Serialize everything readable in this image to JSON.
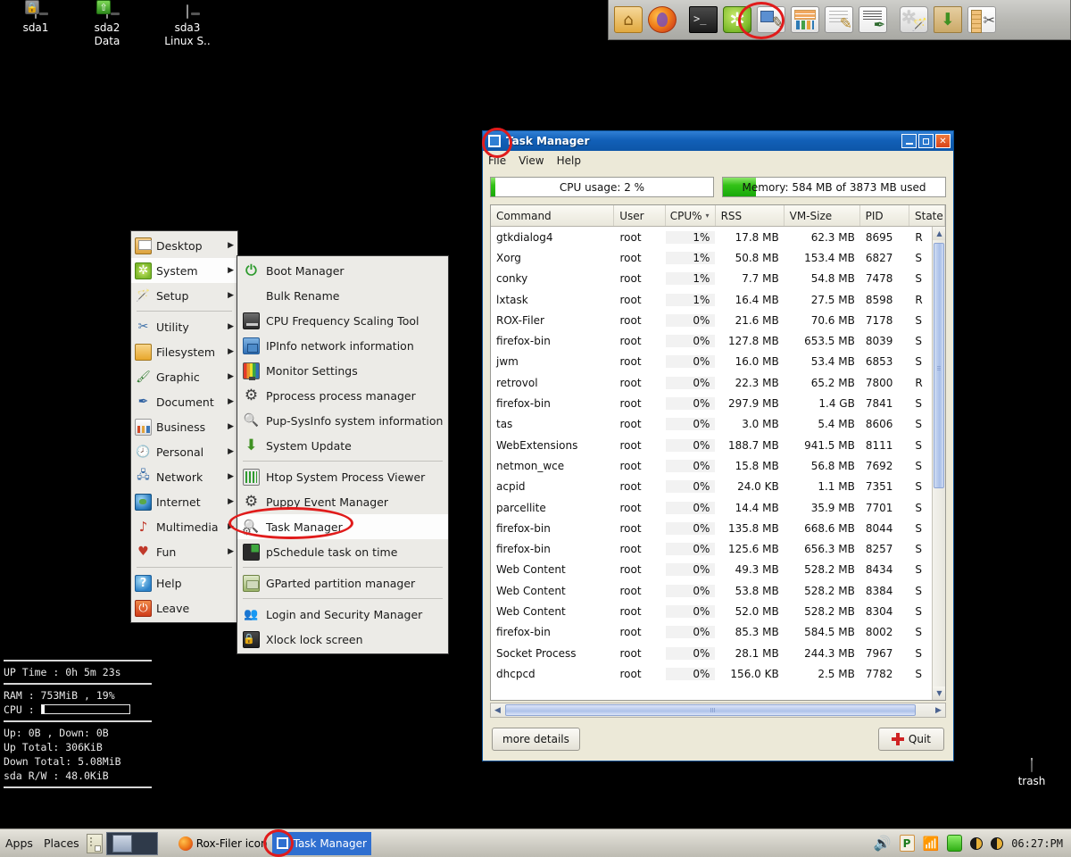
{
  "desktop": {
    "icons": [
      {
        "name": "sda1",
        "sub": "",
        "badge": "lock"
      },
      {
        "name": "sda2",
        "sub": "Data",
        "badge": "mount"
      },
      {
        "name": "sda3",
        "sub": "Linux S..",
        "badge": "none"
      }
    ],
    "trash_label": "trash"
  },
  "launchbar": {
    "items": [
      {
        "icon": "home-folder-icon",
        "tip": "filemanager"
      },
      {
        "icon": "firefox-icon",
        "tip": "browser"
      },
      {
        "icon": "terminal-icon",
        "tip": "terminal"
      },
      {
        "icon": "settings-gear-icon",
        "tip": "setup"
      },
      {
        "icon": "text-editor-icon",
        "tip": "editor"
      },
      {
        "icon": "spreadsheet-icon",
        "tip": "spreadsheet"
      },
      {
        "icon": "wordprocessor-icon",
        "tip": "wordprocessor"
      },
      {
        "icon": "document-pen-icon",
        "tip": "document"
      },
      {
        "icon": "tools-icon",
        "tip": "tools"
      },
      {
        "icon": "package-install-icon",
        "tip": "install"
      },
      {
        "icon": "measure-cut-icon",
        "tip": "utility"
      }
    ]
  },
  "mainmenu": {
    "items": [
      {
        "label": "Desktop",
        "icon": "desktop-icon",
        "arrow": "▶",
        "selected": false,
        "sep_after": false
      },
      {
        "label": "System",
        "icon": "system-gear-icon",
        "arrow": "▶",
        "selected": true,
        "sep_after": false
      },
      {
        "label": "Setup",
        "icon": "setup-wand-icon",
        "arrow": "▶",
        "selected": false,
        "sep_after": true
      },
      {
        "label": "Utility",
        "icon": "utility-icon",
        "arrow": "▶",
        "selected": false,
        "sep_after": false
      },
      {
        "label": "Filesystem",
        "icon": "folder-icon",
        "arrow": "▶",
        "selected": false,
        "sep_after": false
      },
      {
        "label": "Graphic",
        "icon": "graphic-brush-icon",
        "arrow": "▶",
        "selected": false,
        "sep_after": false
      },
      {
        "label": "Document",
        "icon": "document-icon",
        "arrow": "▶",
        "selected": false,
        "sep_after": false
      },
      {
        "label": "Business",
        "icon": "business-chart-icon",
        "arrow": "▶",
        "selected": false,
        "sep_after": false
      },
      {
        "label": "Personal",
        "icon": "personal-clock-icon",
        "arrow": "▶",
        "selected": false,
        "sep_after": false
      },
      {
        "label": "Network",
        "icon": "network-icon",
        "arrow": "▶",
        "selected": false,
        "sep_after": false
      },
      {
        "label": "Internet",
        "icon": "internet-globe-icon",
        "arrow": "▶",
        "selected": false,
        "sep_after": false
      },
      {
        "label": "Multimedia",
        "icon": "multimedia-icon",
        "arrow": "▶",
        "selected": false,
        "sep_after": false
      },
      {
        "label": "Fun",
        "icon": "fun-cards-icon",
        "arrow": "▶",
        "selected": false,
        "sep_after": true
      },
      {
        "label": "Help",
        "icon": "help-icon",
        "arrow": "",
        "selected": false,
        "sep_after": false
      },
      {
        "label": "Leave",
        "icon": "leave-power-icon",
        "arrow": "",
        "selected": false,
        "sep_after": false
      }
    ]
  },
  "submenu": {
    "items": [
      {
        "label": "Boot Manager",
        "icon": "power-icon",
        "selected": false,
        "sep_after": false
      },
      {
        "label": "Bulk Rename",
        "icon": "none",
        "selected": false,
        "sep_after": false
      },
      {
        "label": "CPU Frequency Scaling Tool",
        "icon": "cpu-icon",
        "selected": false,
        "sep_after": false
      },
      {
        "label": "IPInfo network information",
        "icon": "network-info-icon",
        "selected": false,
        "sep_after": false
      },
      {
        "label": "Monitor Settings",
        "icon": "monitor-icon",
        "selected": false,
        "sep_after": false
      },
      {
        "label": "Pprocess process manager",
        "icon": "gear-icon",
        "selected": false,
        "sep_after": false
      },
      {
        "label": "Pup-SysInfo system information",
        "icon": "magnifier-icon",
        "selected": false,
        "sep_after": false
      },
      {
        "label": "System Update",
        "icon": "download-arrow-icon",
        "selected": false,
        "sep_after": true
      },
      {
        "label": "Htop System Process Viewer",
        "icon": "htop-icon",
        "selected": false,
        "sep_after": false
      },
      {
        "label": "Puppy Event Manager",
        "icon": "gear-icon",
        "selected": false,
        "sep_after": false
      },
      {
        "label": "Task Manager",
        "icon": "task-manager-icon",
        "selected": true,
        "sep_after": false
      },
      {
        "label": "pSchedule task on time",
        "icon": "schedule-clock-icon",
        "selected": false,
        "sep_after": true
      },
      {
        "label": "GParted partition manager",
        "icon": "gparted-icon",
        "selected": false,
        "sep_after": true
      },
      {
        "label": "Login and Security Manager",
        "icon": "users-icon",
        "selected": false,
        "sep_after": false
      },
      {
        "label": "Xlock lock screen",
        "icon": "lock-screen-icon",
        "selected": false,
        "sep_after": false
      }
    ]
  },
  "taskmanager": {
    "title": "Task Manager",
    "menus": [
      "File",
      "View",
      "Help"
    ],
    "window_buttons": {
      "minimize": "_",
      "maximize": "□",
      "close": "✕"
    },
    "cpu_bar": {
      "text": "CPU usage: 2 %",
      "percent": 2
    },
    "mem_bar": {
      "text": "Memory: 584 MB of 3873 MB used",
      "percent": 15
    },
    "columns": [
      "Command",
      "User",
      "CPU%",
      "RSS",
      "VM-Size",
      "PID",
      "State"
    ],
    "sort_column": "CPU%",
    "sort_arrow": "▾",
    "rows": [
      {
        "command": "gtkdialog4",
        "user": "root",
        "cpu": "1%",
        "rss": "17.8 MB",
        "vm": "62.3 MB",
        "pid": "8695",
        "state": "R"
      },
      {
        "command": "Xorg",
        "user": "root",
        "cpu": "1%",
        "rss": "50.8 MB",
        "vm": "153.4 MB",
        "pid": "6827",
        "state": "S"
      },
      {
        "command": "conky",
        "user": "root",
        "cpu": "1%",
        "rss": "7.7 MB",
        "vm": "54.8 MB",
        "pid": "7478",
        "state": "S"
      },
      {
        "command": "lxtask",
        "user": "root",
        "cpu": "1%",
        "rss": "16.4 MB",
        "vm": "27.5 MB",
        "pid": "8598",
        "state": "R"
      },
      {
        "command": "ROX-Filer",
        "user": "root",
        "cpu": "0%",
        "rss": "21.6 MB",
        "vm": "70.6 MB",
        "pid": "7178",
        "state": "S"
      },
      {
        "command": "firefox-bin",
        "user": "root",
        "cpu": "0%",
        "rss": "127.8 MB",
        "vm": "653.5 MB",
        "pid": "8039",
        "state": "S"
      },
      {
        "command": "jwm",
        "user": "root",
        "cpu": "0%",
        "rss": "16.0 MB",
        "vm": "53.4 MB",
        "pid": "6853",
        "state": "S"
      },
      {
        "command": "retrovol",
        "user": "root",
        "cpu": "0%",
        "rss": "22.3 MB",
        "vm": "65.2 MB",
        "pid": "7800",
        "state": "R"
      },
      {
        "command": "firefox-bin",
        "user": "root",
        "cpu": "0%",
        "rss": "297.9 MB",
        "vm": "1.4 GB",
        "pid": "7841",
        "state": "S"
      },
      {
        "command": "tas",
        "user": "root",
        "cpu": "0%",
        "rss": "3.0 MB",
        "vm": "5.4 MB",
        "pid": "8606",
        "state": "S"
      },
      {
        "command": "WebExtensions",
        "user": "root",
        "cpu": "0%",
        "rss": "188.7 MB",
        "vm": "941.5 MB",
        "pid": "8111",
        "state": "S"
      },
      {
        "command": "netmon_wce",
        "user": "root",
        "cpu": "0%",
        "rss": "15.8 MB",
        "vm": "56.8 MB",
        "pid": "7692",
        "state": "S"
      },
      {
        "command": "acpid",
        "user": "root",
        "cpu": "0%",
        "rss": "24.0 KB",
        "vm": "1.1 MB",
        "pid": "7351",
        "state": "S"
      },
      {
        "command": "parcellite",
        "user": "root",
        "cpu": "0%",
        "rss": "14.4 MB",
        "vm": "35.9 MB",
        "pid": "7701",
        "state": "S"
      },
      {
        "command": "firefox-bin",
        "user": "root",
        "cpu": "0%",
        "rss": "135.8 MB",
        "vm": "668.6 MB",
        "pid": "8044",
        "state": "S"
      },
      {
        "command": "firefox-bin",
        "user": "root",
        "cpu": "0%",
        "rss": "125.6 MB",
        "vm": "656.3 MB",
        "pid": "8257",
        "state": "S"
      },
      {
        "command": "Web Content",
        "user": "root",
        "cpu": "0%",
        "rss": "49.3 MB",
        "vm": "528.2 MB",
        "pid": "8434",
        "state": "S"
      },
      {
        "command": "Web Content",
        "user": "root",
        "cpu": "0%",
        "rss": "53.8 MB",
        "vm": "528.2 MB",
        "pid": "8384",
        "state": "S"
      },
      {
        "command": "Web Content",
        "user": "root",
        "cpu": "0%",
        "rss": "52.0 MB",
        "vm": "528.2 MB",
        "pid": "8304",
        "state": "S"
      },
      {
        "command": "firefox-bin",
        "user": "root",
        "cpu": "0%",
        "rss": "85.3 MB",
        "vm": "584.5 MB",
        "pid": "8002",
        "state": "S"
      },
      {
        "command": "Socket Process",
        "user": "root",
        "cpu": "0%",
        "rss": "28.1 MB",
        "vm": "244.3 MB",
        "pid": "7967",
        "state": "S"
      },
      {
        "command": "dhcpcd",
        "user": "root",
        "cpu": "0%",
        "rss": "156.0 KB",
        "vm": "2.5 MB",
        "pid": "7782",
        "state": "S"
      }
    ],
    "more_details_label": "more details",
    "quit_label": "Quit"
  },
  "conky": {
    "uptime": "UP Time : 0h 5m 23s",
    "ram": "RAM : 753MiB , 19%",
    "cpu_label": "CPU :",
    "cpu_percent": 3,
    "net": "Up: 0B   , Down: 0B",
    "up_total": "Up Total: 306KiB",
    "down_total": "Down Total: 5.08MiB",
    "disk": "sda R/W : 48.0KiB"
  },
  "taskbar": {
    "apps_label": "Apps",
    "places_label": "Places",
    "tasks": [
      {
        "label": "Rox-Filer icon",
        "icon": "firefox-icon",
        "active": false
      },
      {
        "label": "Task Manager",
        "icon": "task-manager-icon",
        "active": true
      }
    ],
    "tray": {
      "volume_icon": "volume-icon",
      "clipboard_label": "P",
      "wifi_icon": "wifi-icon",
      "drive_icon": "drive-icon",
      "brightness_icon": "brightness-icon",
      "contrast_icon": "contrast-icon",
      "clock": "06:27:PM"
    }
  }
}
